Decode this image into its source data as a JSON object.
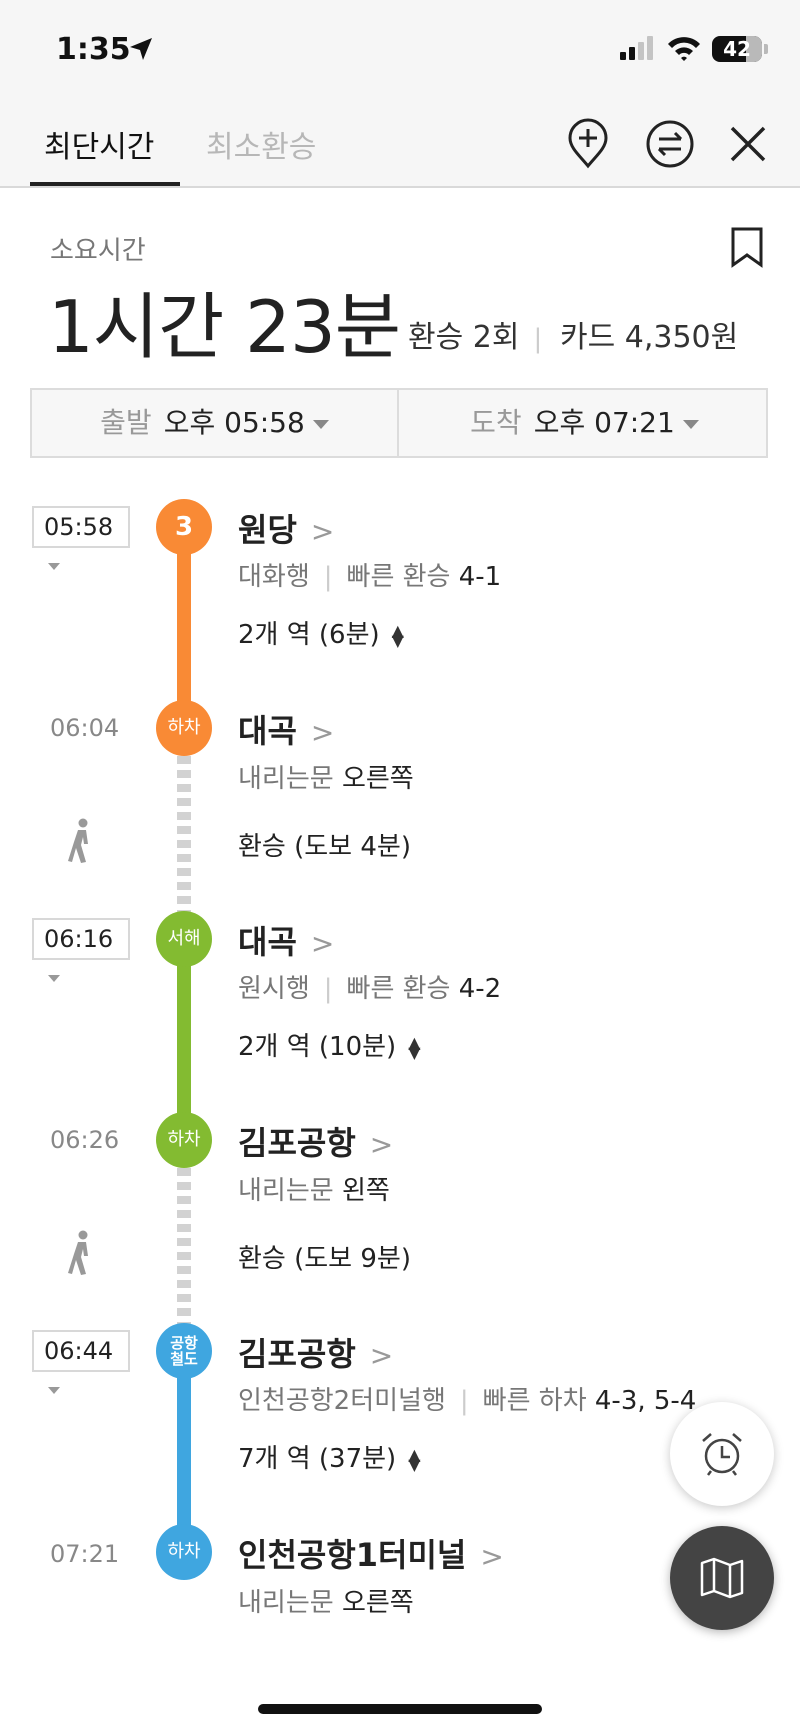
{
  "status_bar": {
    "time": "1:35",
    "battery": "42"
  },
  "tabs": [
    {
      "label": "최단시간",
      "active": true
    },
    {
      "label": "최소환승",
      "active": false
    }
  ],
  "icons": {
    "add_stop": "location-plus-icon",
    "swap": "swap-icon",
    "close": "close-icon",
    "bookmark": "bookmark-icon",
    "walk": "walking-person-icon",
    "alarm": "alarm-clock-icon",
    "map": "map-icon"
  },
  "summary": {
    "duration_label": "소요시간",
    "duration": "1시간 23분",
    "transfers": "환승 2회",
    "fare": "카드 4,350원"
  },
  "times": {
    "depart_label": "출발",
    "depart_value": "오후 05:58",
    "arrive_label": "도착",
    "arrive_value": "오후 07:21"
  },
  "colors": {
    "line3": "#f98a35",
    "seohae": "#83bb31",
    "airport_rail": "#3fa6e0"
  },
  "route": [
    {
      "time": "05:58",
      "badge": "3",
      "station": "원당",
      "direction": "대화행",
      "fast_label": "빠른 환승",
      "fast_value": "4-1",
      "stops": "2개 역 (6분)"
    },
    {
      "time": "06:04",
      "badge": "하차",
      "station": "대곡",
      "door_label": "내리는문",
      "door_value": "오른쪽"
    },
    {
      "walk": "환승 (도보 4분)"
    },
    {
      "time": "06:16",
      "badge": "서해",
      "station": "대곡",
      "direction": "원시행",
      "fast_label": "빠른 환승",
      "fast_value": "4-2",
      "stops": "2개 역 (10분)"
    },
    {
      "time": "06:26",
      "badge": "하차",
      "station": "김포공항",
      "door_label": "내리는문",
      "door_value": "왼쪽"
    },
    {
      "walk": "환승 (도보 9분)"
    },
    {
      "time": "06:44",
      "badge": "공항\n철도",
      "badge_line1": "공항",
      "badge_line2": "철도",
      "station": "김포공항",
      "direction": "인천공항2터미널행",
      "fast_label": "빠른 하차",
      "fast_value": "4-3, 5-4",
      "stops": "7개 역 (37분)"
    },
    {
      "time": "07:21",
      "badge": "하차",
      "station": "인천공항1터미널",
      "door_label": "내리는문",
      "door_value": "오른쪽"
    }
  ]
}
